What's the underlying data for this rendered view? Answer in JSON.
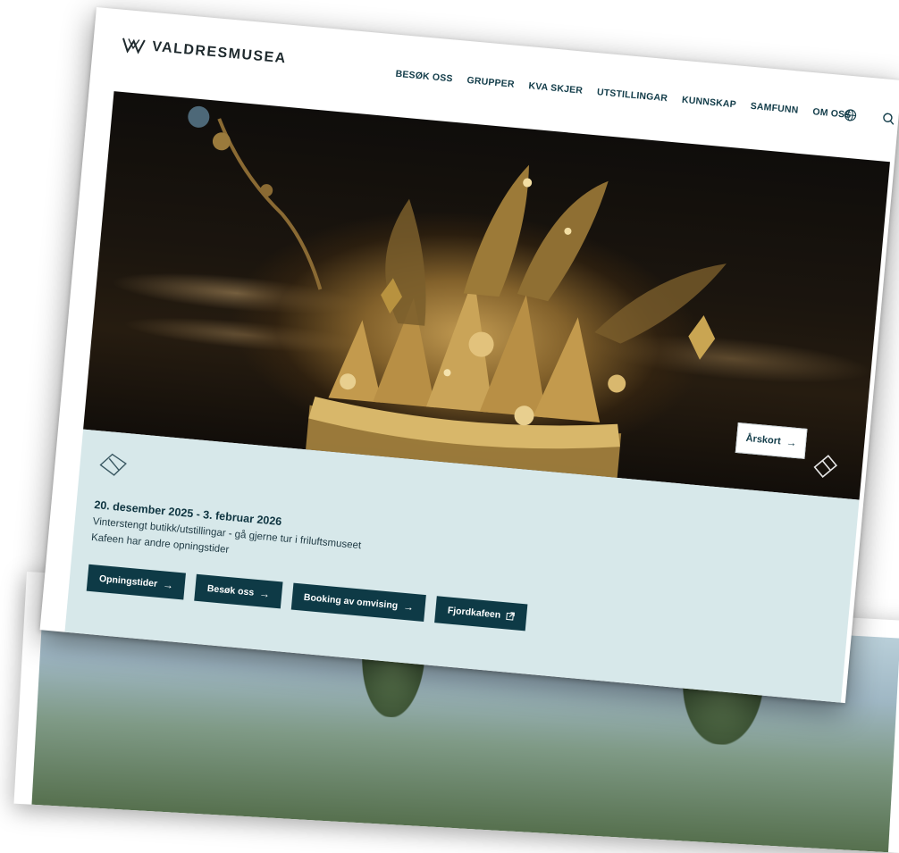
{
  "header": {
    "logo_text": "VALDRESMUSEA",
    "nav": [
      {
        "label": "BESØK OSS"
      },
      {
        "label": "GRUPPER"
      },
      {
        "label": "KVA SKJER"
      },
      {
        "label": "UTSTILLINGAR"
      },
      {
        "label": "KUNNSKAP"
      },
      {
        "label": "SAMFUNN"
      },
      {
        "label": "OM OSS"
      }
    ],
    "icons": [
      "globe-icon",
      "search-icon"
    ]
  },
  "hero": {
    "image_subject": "crown-photo",
    "cta_label": "Årskort",
    "cta_icon": "arrow-right-icon",
    "ticket_icon": "ticket-icon"
  },
  "notice": {
    "ticket_icon": "ticket-icon",
    "date": "20. desember 2025 - 3. februar 2026",
    "line1": "Vinterstengt butikk/utstillingar - gå gjerne tur i friluftsmuseet",
    "line2": "Kafeen har andre opningstider",
    "buttons": [
      {
        "label": "Opningstider",
        "icon": "arrow-right-icon"
      },
      {
        "label": "Besøk oss",
        "icon": "arrow-right-icon"
      },
      {
        "label": "Booking av omvising",
        "icon": "arrow-right-icon"
      },
      {
        "label": "Fjordkafeen",
        "icon": "external-link-icon"
      }
    ]
  },
  "colors": {
    "brand_dark": "#0e3a46",
    "notice_background": "#d7e8ea",
    "nav_text": "#123c49"
  }
}
